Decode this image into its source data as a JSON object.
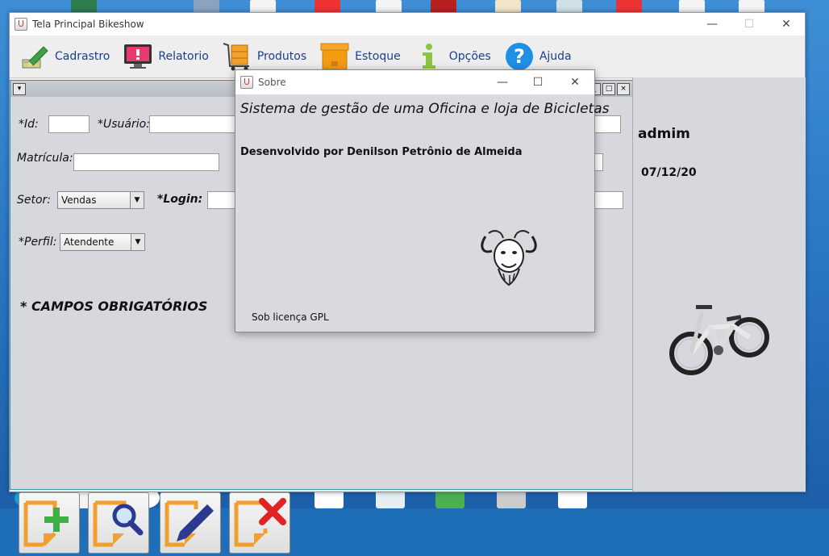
{
  "main_window": {
    "title": "Tela Principal Bikeshow",
    "controls": {
      "minimize": "—",
      "maximize": "☐",
      "close": "✕"
    }
  },
  "menubar": {
    "items": [
      {
        "label": "Cadrastro",
        "icon": "pencil-edit-icon"
      },
      {
        "label": "Relatorio",
        "icon": "monitor-alert-icon"
      },
      {
        "label": "Produtos",
        "icon": "cart-icon"
      },
      {
        "label": "Estoque",
        "icon": "box-icon"
      },
      {
        "label": "Opções",
        "icon": "info-icon"
      },
      {
        "label": "Ajuda",
        "icon": "help-icon"
      }
    ]
  },
  "user_form": {
    "id_label": "*Id:",
    "usuario_label": "*Usuário:",
    "matricula_label": "Matrícula:",
    "setor_label": "Setor:",
    "setor_value": "Vendas",
    "login_label": "*Login:",
    "perfil_label": "*Perfil:",
    "perfil_value": "Atendente",
    "required_note": "*  CAMPOS OBRIGATÓRIOS",
    "actions": [
      "add-button",
      "search-button",
      "edit-button",
      "delete-button"
    ]
  },
  "side_panel": {
    "user": "admim",
    "date": "07/12/20"
  },
  "about_dialog": {
    "title": "Sobre",
    "heading": "Sistema de gestão de uma Oficina e loja de Bicicletas",
    "developer": "Desenvolvido por Denilson Petrônio de Almeida",
    "license": "Sob licença GPL"
  },
  "colors": {
    "menu_text": "#1a3f8a",
    "frame_bg": "#d6d8de",
    "add_plus": "#3cb043",
    "delete_x": "#e02424",
    "doc_orange": "#f0a030"
  }
}
